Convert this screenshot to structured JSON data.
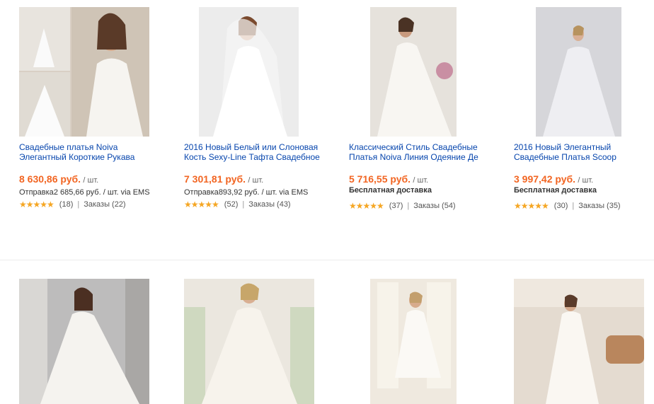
{
  "products": [
    {
      "title1": "Свадебные платья Noiva",
      "title2": "Элегантный Короткие Рукава",
      "price": "8 630,86 руб.",
      "unit": "/ шт.",
      "ship_label": "Отправка",
      "ship_price": "2 685,66 руб.",
      "ship_suffix": "/ шт. via EMS",
      "stars": "★★★★★",
      "reviews": "(18)",
      "orders": "Заказы (22)"
    },
    {
      "title1": "2016 Новый Белый или Слоновая",
      "title2": "Кость Sexy-Line Тафта Свадебное",
      "price": "7 301,81 руб.",
      "unit": "/ шт.",
      "ship_label": "Отправка",
      "ship_price": "893,92 руб.",
      "ship_suffix": "/ шт. via EMS",
      "stars": "★★★★★",
      "reviews": "(52)",
      "orders": "Заказы (43)"
    },
    {
      "title1": "Классический Стиль Свадебные",
      "title2": "Платья Noiva Линия Одеяние Де",
      "price": "5 716,55 руб.",
      "unit": "/ шт.",
      "free_ship": "Бесплатная доставка",
      "stars": "★★★★★",
      "reviews": "(37)",
      "orders": "Заказы (54)"
    },
    {
      "title1": "2016 Новый Элегантный",
      "title2": "Свадебные Платья Scoop",
      "price": "3 997,42 руб.",
      "unit": "/ шт.",
      "free_ship": "Бесплатная доставка",
      "stars": "★★★★★",
      "reviews": "(30)",
      "orders": "Заказы (35)"
    }
  ],
  "images": [
    "wedding-dress-photo-1",
    "wedding-dress-photo-2",
    "wedding-dress-photo-3",
    "wedding-dress-photo-4",
    "wedding-dress-photo-5",
    "wedding-dress-photo-6",
    "wedding-dress-photo-7",
    "wedding-dress-photo-8"
  ]
}
